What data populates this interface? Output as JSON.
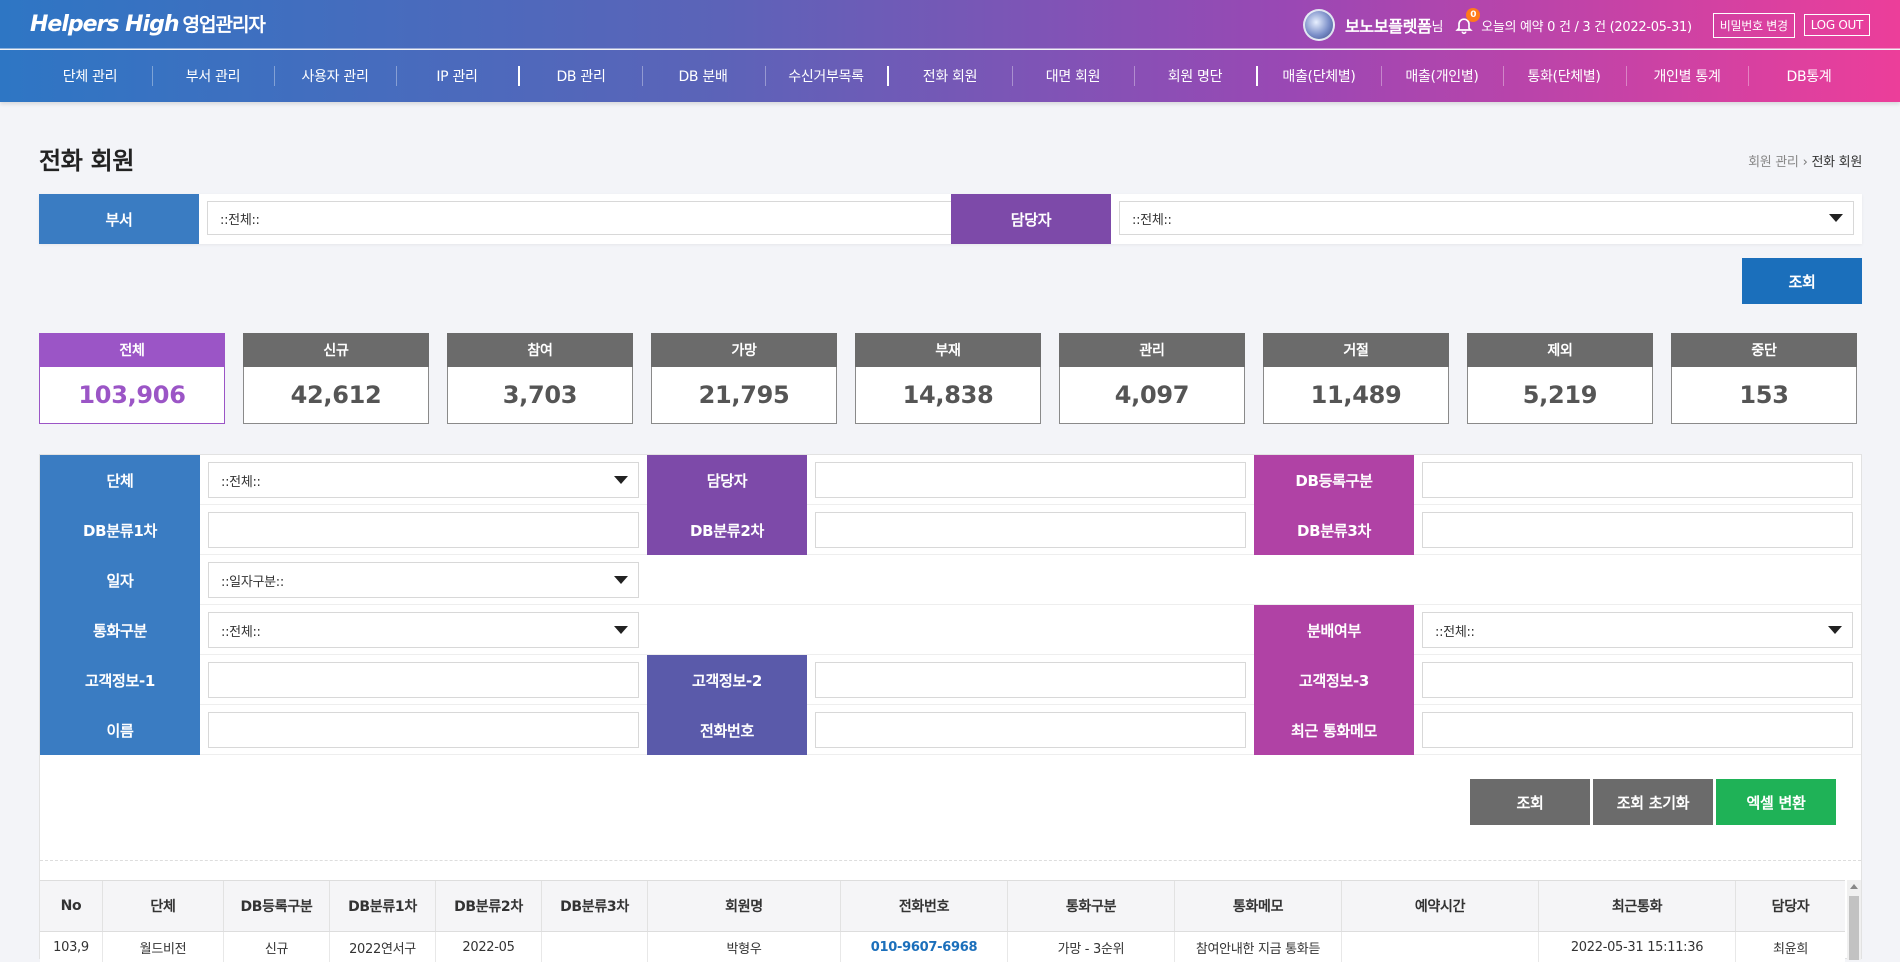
{
  "header": {
    "logo_main": "Helpers High",
    "logo_sub": "영업관리자",
    "user_name": "보노보플렛폼",
    "user_suffix": "님",
    "notification_count": "0",
    "reservation_text": "오늘의 예약 0 건 / 3 건 (2022-05-31)",
    "change_password_label": "비밀번호 변경",
    "logout_label": "LOG OUT"
  },
  "nav": {
    "items": [
      "단체 관리",
      "부서 관리",
      "사용자 관리",
      "IP 관리",
      "DB 관리",
      "DB 분배",
      "수신거부목록",
      "전화 회원",
      "대면 회원",
      "회원 명단",
      "매출(단체별)",
      "매출(개인별)",
      "통화(단체별)",
      "개인별 통계",
      "DB통계"
    ]
  },
  "page": {
    "title": "전화 회원",
    "breadcrumb_parent": "회원 관리",
    "breadcrumb_current": "전화 회원"
  },
  "top_filter": {
    "dept_label": "부서",
    "dept_value": "::전체::",
    "manager_label": "담당자",
    "manager_value": "::전체::",
    "search_label": "조회"
  },
  "stats": [
    {
      "label": "전체",
      "value": "103,906"
    },
    {
      "label": "신규",
      "value": "42,612"
    },
    {
      "label": "참여",
      "value": "3,703"
    },
    {
      "label": "가망",
      "value": "21,795"
    },
    {
      "label": "부재",
      "value": "14,838"
    },
    {
      "label": "관리",
      "value": "4,097"
    },
    {
      "label": "거절",
      "value": "11,489"
    },
    {
      "label": "제외",
      "value": "5,219"
    },
    {
      "label": "중단",
      "value": "153"
    }
  ],
  "search": {
    "group_label": "단체",
    "group_value": "::전체::",
    "manager_label": "담당자",
    "manager_value": "",
    "db_reg_label": "DB등록구분",
    "db_reg_value": "",
    "db_cat1_label": "DB분류1차",
    "db_cat1_value": "",
    "db_cat2_label": "DB분류2차",
    "db_cat2_value": "",
    "db_cat3_label": "DB분류3차",
    "db_cat3_value": "",
    "date_label": "일자",
    "date_value": "::일자구분::",
    "call_type_label": "통화구분",
    "call_type_value": "::전체::",
    "distribute_label": "분배여부",
    "distribute_value": "::전체::",
    "cust1_label": "고객정보-1",
    "cust1_value": "",
    "cust2_label": "고객정보-2",
    "cust2_value": "",
    "cust3_label": "고객정보-3",
    "cust3_value": "",
    "name_label": "이름",
    "name_value": "",
    "phone_label": "전화번호",
    "phone_value": "",
    "memo_label": "최근 통화메모",
    "memo_value": ""
  },
  "actions": {
    "search": "조회",
    "reset": "조회 초기화",
    "excel": "엑셀 변환"
  },
  "table": {
    "headers": [
      "No",
      "단체",
      "DB등록구분",
      "DB분류1차",
      "DB분류2차",
      "DB분류3차",
      "회원명",
      "전화번호",
      "통화구분",
      "통화메모",
      "예약시간",
      "최근통화",
      "담당자"
    ],
    "rows": [
      [
        "103,9",
        "월드비전",
        "신규",
        "2022연서구",
        "2022-05",
        "",
        "박형우",
        "010-9607-6968",
        "가망 - 3순위",
        "참여안내한 지금 통화듣",
        "",
        "2022-05-31 15:11:36",
        "최윤희"
      ]
    ]
  },
  "colors": {
    "blue": "#3a7cc2",
    "purple": "#7d4aa9",
    "magenta": "#b042a5",
    "active_stat": "#9b55c6",
    "search_button": "#1b6fbb",
    "excel_button": "#1fb257"
  }
}
